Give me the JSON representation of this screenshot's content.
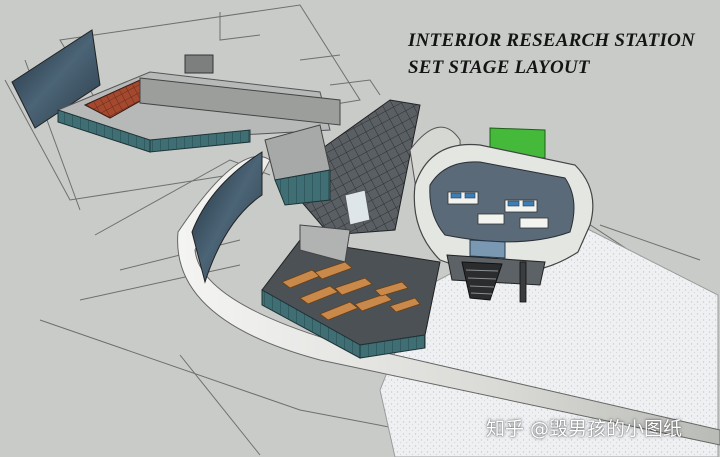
{
  "title": {
    "line1": "INTERIOR RESEARCH STATION",
    "line2": "SET STAGE LAYOUT"
  },
  "watermark": "知乎 @毁男孩的小图纸",
  "colors": {
    "ground": "#c9cbc9",
    "wall": "#e8e8e4",
    "glass": "#3f6f74",
    "floor_tile": "#5a5f63",
    "wood_desk": "#c8894b",
    "chroma_green": "#44b93a",
    "backdrop_sky": "#2f4454",
    "white_floor": "#eef0f2"
  },
  "icons": [
    "sky-backdrop-panel-left",
    "sky-backdrop-panel-middle",
    "green-screen-panel",
    "elevated-control-room",
    "staircase"
  ]
}
